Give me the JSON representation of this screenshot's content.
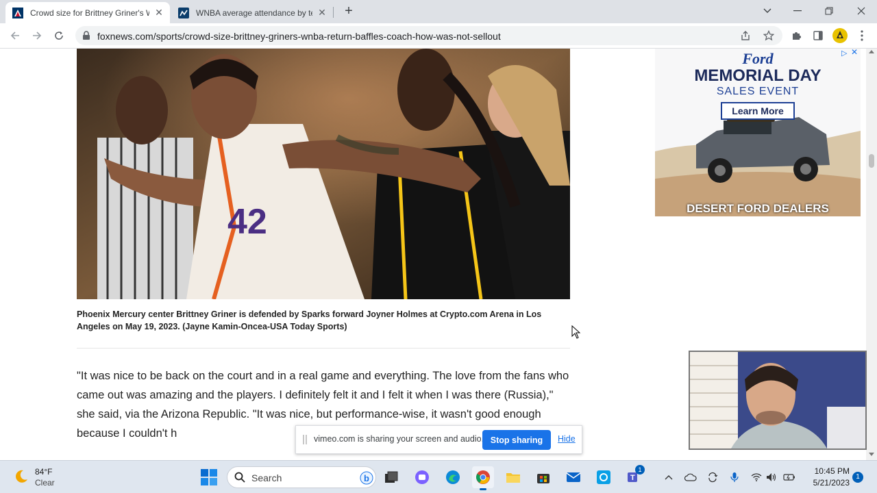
{
  "tabs": [
    {
      "title": "Crowd size for Brittney Griner's W"
    },
    {
      "title": "WNBA average attendance by te"
    }
  ],
  "address": {
    "url": "foxnews.com/sports/crowd-size-brittney-griners-wnba-return-baffles-coach-how-was-not-sellout"
  },
  "article": {
    "caption": "Phoenix Mercury center Brittney Griner is defended by Sparks forward Joyner Holmes at Crypto.com Arena in Los Angeles on May 19, 2023. (Jayne Kamin-Oncea-USA Today Sports)",
    "paragraph": "\"It was nice to be back on the court and in a real game and everything. The love from the fans who came out was amazing and the players. I definitely felt it and I felt it when I was there (Russia),\" she said, via the Arizona Republic. \"It was nice, but performance-wise, it wasn't good enough because I couldn't h",
    "jersey_number": "42"
  },
  "ad": {
    "brand": "Ford",
    "headline": "MEMORIAL DAY",
    "subhead": "SALES EVENT",
    "cta": "Learn More",
    "footer": "DESERT FORD DEALERS"
  },
  "share_banner": {
    "message": "vimeo.com is sharing your screen and audio.",
    "stop_label": "Stop sharing",
    "hide_label": "Hide"
  },
  "taskbar": {
    "weather_temp": "84°F",
    "weather_cond": "Clear",
    "search_placeholder": "Search",
    "teams_badge": "1",
    "time": "10:45 PM",
    "date": "5/21/2023",
    "notification_count": "1"
  },
  "colors": {
    "accent": "#1a73e8",
    "mercury_orange": "#e56020",
    "sparks_gold": "#f5c518"
  }
}
